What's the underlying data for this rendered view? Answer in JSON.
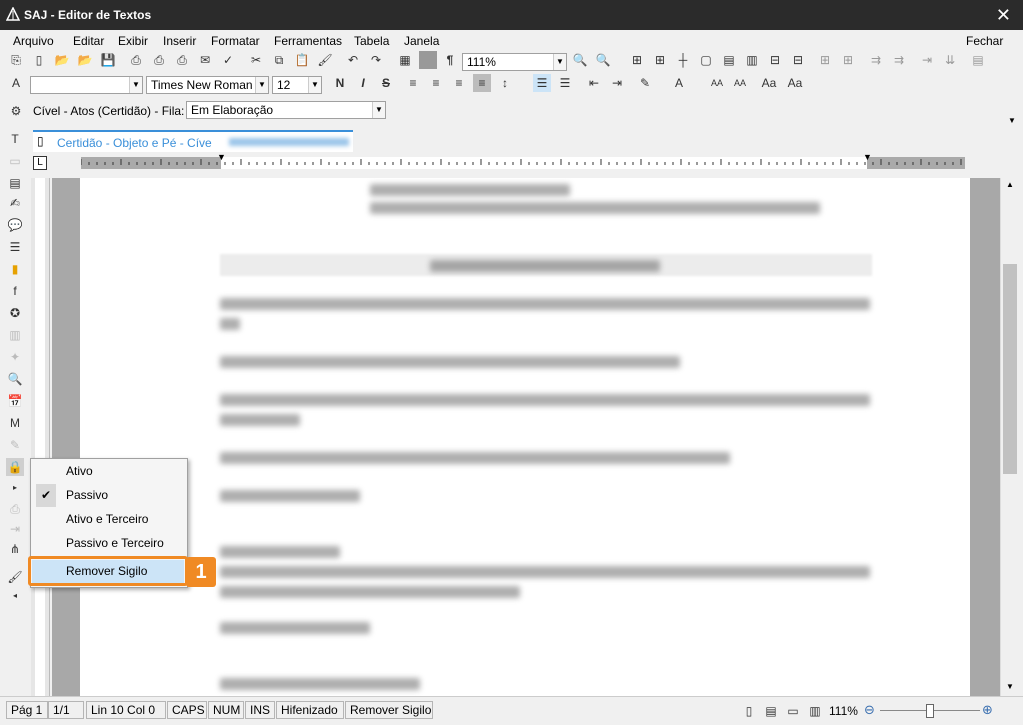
{
  "window": {
    "title": "SAJ - Editor de Textos"
  },
  "menu": {
    "items": [
      "Arquivo",
      "Editar",
      "Exibir",
      "Inserir",
      "Formatar",
      "Ferramentas",
      "Tabela",
      "Janela"
    ],
    "close_label": "Fechar"
  },
  "toolbar": {
    "zoom_value": "111%",
    "font_name": "Times New Roman",
    "font_size": "12"
  },
  "filter_row": {
    "label": "Cível - Atos (Certidão) - Fila:",
    "value": "Em Elaboração"
  },
  "tab": {
    "label": "Certidão - Objeto e Pé - Cíve"
  },
  "context_menu": {
    "items": [
      {
        "label": "Ativo",
        "checked": false
      },
      {
        "label": "Passivo",
        "checked": true
      },
      {
        "label": "Ativo e Terceiro",
        "checked": false
      },
      {
        "label": "Passivo e Terceiro",
        "checked": false
      },
      {
        "label": "Remover Sigilo",
        "checked": false,
        "highlighted": true
      }
    ]
  },
  "callout": {
    "number": "1",
    "color": "#f08a24"
  },
  "statusbar": {
    "page": "Pág 1",
    "page_count": "1/1",
    "line_col": "Lin 10  Col 0",
    "caps": "CAPS",
    "num": "NUM",
    "ins": "INS",
    "hyphen": "Hifenizado",
    "secrecy": "Remover Sigilo",
    "zoom": "111%"
  },
  "colors": {
    "accent": "#f08a24",
    "menu_highlight": "#cce4f7"
  }
}
